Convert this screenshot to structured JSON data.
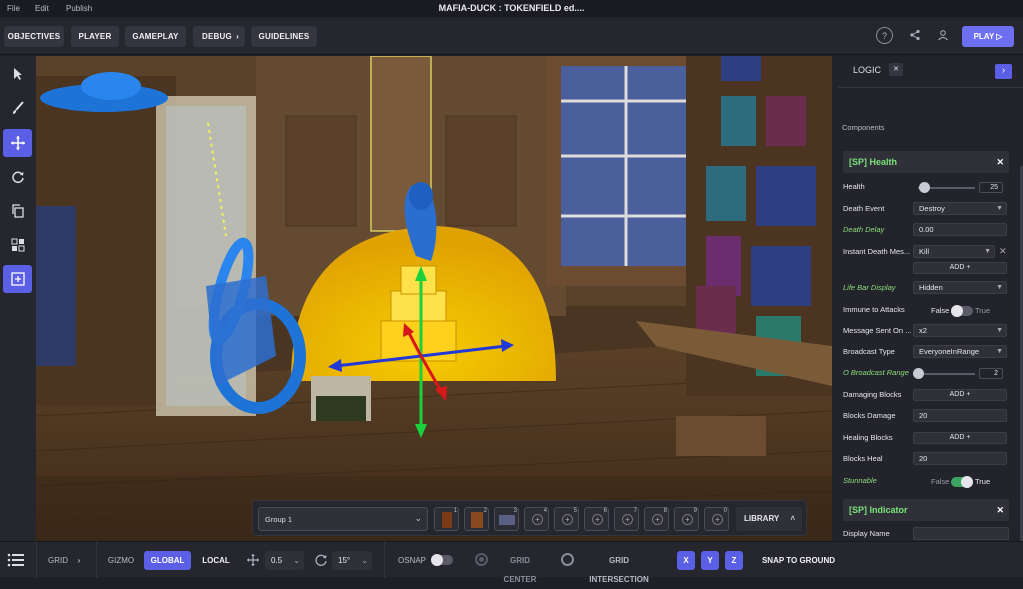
{
  "menu": {
    "file": "File",
    "edit": "Edit",
    "publish": "Publish",
    "title": "MAFIA-DUCK : TOKENFIELD ed...."
  },
  "topbar": {
    "tabs": [
      "OBJECTIVES",
      "PLAYER",
      "GAMEPLAY",
      "DEBUG",
      "GUIDELINES"
    ],
    "debug_chevron": "›",
    "help_icon": "?",
    "play_label": "PLAY ▷"
  },
  "panel": {
    "tab": "LOGIC",
    "tab_close": "✕",
    "collapse_icon": "›",
    "components_label": "Components",
    "health": {
      "title": "[SP] Health",
      "close": "✕",
      "health_label": "Health",
      "health_value": "25",
      "health_fraction": 0.05,
      "death_event_label": "Death Event",
      "death_event_value": "Destroy",
      "death_delay_label": "Death Delay",
      "death_delay_value": "0.00",
      "instant_death_label": "Instant Death Mes...",
      "instant_death_value": "Kill",
      "add_label": "ADD +",
      "life_bar_label": "Life Bar Display",
      "life_bar_value": "Hidden",
      "immune_label": "Immune to Attacks",
      "immune_false": "False",
      "immune_true": "True",
      "message_label": "Message Sent On ...",
      "message_value": "x2",
      "broadcast_type_label": "Broadcast Type",
      "broadcast_type_value": "EveryoneInRange",
      "broadcast_range_label": "O Broadcast Range",
      "broadcast_range_value": "2",
      "broadcast_range_fraction": 0.0,
      "damaging_blocks_label": "Damaging Blocks",
      "blocks_damage_label": "Blocks Damage",
      "blocks_damage_value": "20",
      "healing_blocks_label": "Healing Blocks",
      "blocks_heal_label": "Blocks Heal",
      "blocks_heal_value": "20",
      "stunnable_label": "Stunnable",
      "stunnable_false": "False",
      "stunnable_true": "True"
    },
    "indicator": {
      "title": "[SP] Indicator",
      "close": "✕",
      "display_name_label": "Display Name"
    }
  },
  "inventory": {
    "group_label": "Group 1",
    "slots": [
      "1",
      "2",
      "3",
      "4",
      "5",
      "6",
      "7",
      "8",
      "9",
      "0"
    ],
    "library_label": "LIBRARY"
  },
  "bottombar": {
    "grid_label": "GRID",
    "gizmo_label": "GIZMO",
    "global_label": "GLOBAL",
    "local_label": "LOCAL",
    "move_value": "0.5",
    "rotate_value": "15°",
    "osnap_label": "OSNAP",
    "grid_center_label": "GRID CENTER",
    "grid_intersection_label": "GRID INTERSECTION",
    "x_label": "X",
    "y_label": "Y",
    "z_label": "Z",
    "snap_label": "SNAP TO GROUND"
  },
  "colors": {
    "accent": "#5b5fe6",
    "play": "#6d6ff2",
    "component_title": "#7be37a",
    "italic_label": "#8ddc7c"
  }
}
